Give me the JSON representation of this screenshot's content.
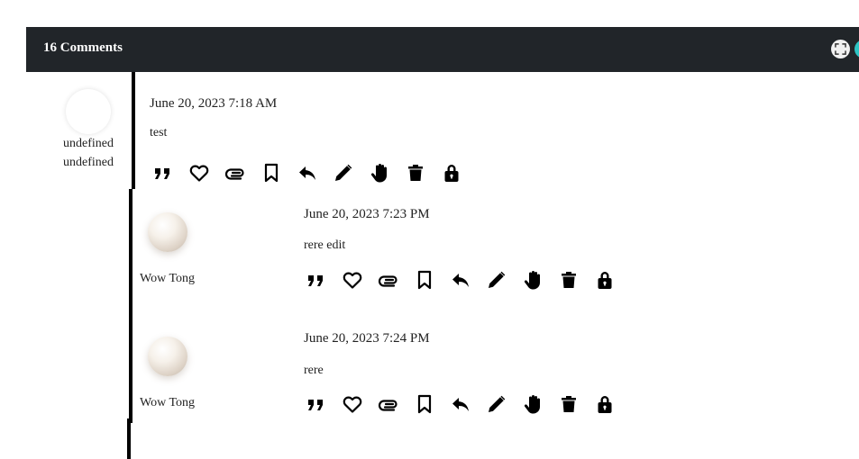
{
  "header": {
    "title": "16 Comments",
    "fullscreen_icon": "fullscreen-icon",
    "accent": "#2ec4c4"
  },
  "comments": [
    {
      "author_line1": "undefined",
      "author_line2": "undefined",
      "date": "June 20, 2023 7:18 AM",
      "text": "test"
    },
    {
      "author": "Wow Tong",
      "date": "June 20, 2023 7:23 PM",
      "text": "rere edit"
    },
    {
      "author": "Wow Tong",
      "date": "June 20, 2023 7:24 PM",
      "text": "rere"
    }
  ],
  "actions": [
    "quote-icon",
    "heart-icon",
    "paperclip-icon",
    "bookmark-icon",
    "reply-icon",
    "pencil-icon",
    "hand-icon",
    "trash-icon",
    "lock-icon"
  ]
}
